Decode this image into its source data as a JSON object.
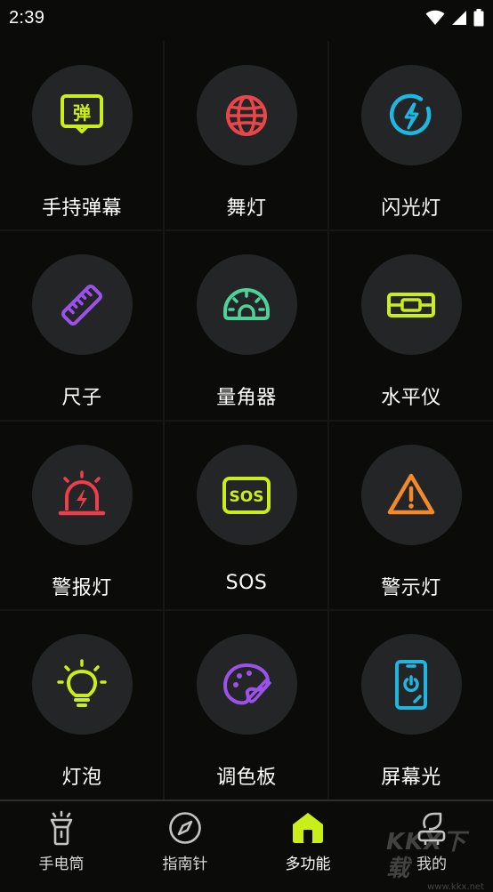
{
  "status": {
    "time": "2:39",
    "icons": [
      "wifi-icon",
      "cellular-signal-icon",
      "battery-icon"
    ]
  },
  "grid": {
    "items": [
      {
        "label": "手持弹幕",
        "icon": "danmaku-icon",
        "color": "#c8ef18",
        "glyph": "弹"
      },
      {
        "label": "舞灯",
        "icon": "disco-ball-icon",
        "color": "#e8464a"
      },
      {
        "label": "闪光灯",
        "icon": "flash-icon",
        "color": "#1fb6df"
      },
      {
        "label": "尺子",
        "icon": "ruler-icon",
        "color": "#9b52e8"
      },
      {
        "label": "量角器",
        "icon": "protractor-icon",
        "color": "#4ed29c"
      },
      {
        "label": "水平仪",
        "icon": "level-icon",
        "color": "#c8ef18"
      },
      {
        "label": "警报灯",
        "icon": "siren-icon",
        "color": "#ee3e4c"
      },
      {
        "label": "SOS",
        "icon": "sos-icon",
        "color": "#c8ef18",
        "glyph": "SOS"
      },
      {
        "label": "警示灯",
        "icon": "warning-icon",
        "color": "#f28a2c"
      },
      {
        "label": "灯泡",
        "icon": "bulb-icon",
        "color": "#c8ef18"
      },
      {
        "label": "调色板",
        "icon": "palette-icon",
        "color": "#9b52e8"
      },
      {
        "label": "屏幕光",
        "icon": "screen-light-icon",
        "color": "#1fb6df"
      }
    ]
  },
  "tabbar": {
    "tabs": [
      {
        "label": "手电筒",
        "icon": "flashlight-icon",
        "active": false
      },
      {
        "label": "指南针",
        "icon": "compass-icon",
        "active": false
      },
      {
        "label": "多功能",
        "icon": "home-icon",
        "active": true
      },
      {
        "label": "我的",
        "icon": "profile-icon",
        "active": false
      }
    ]
  },
  "watermark": {
    "text": "KKX下载",
    "subtext": "www.kkx.net"
  },
  "colors": {
    "background": "#0b0b09",
    "circle": "#242526",
    "accent": "#c8ef18"
  }
}
